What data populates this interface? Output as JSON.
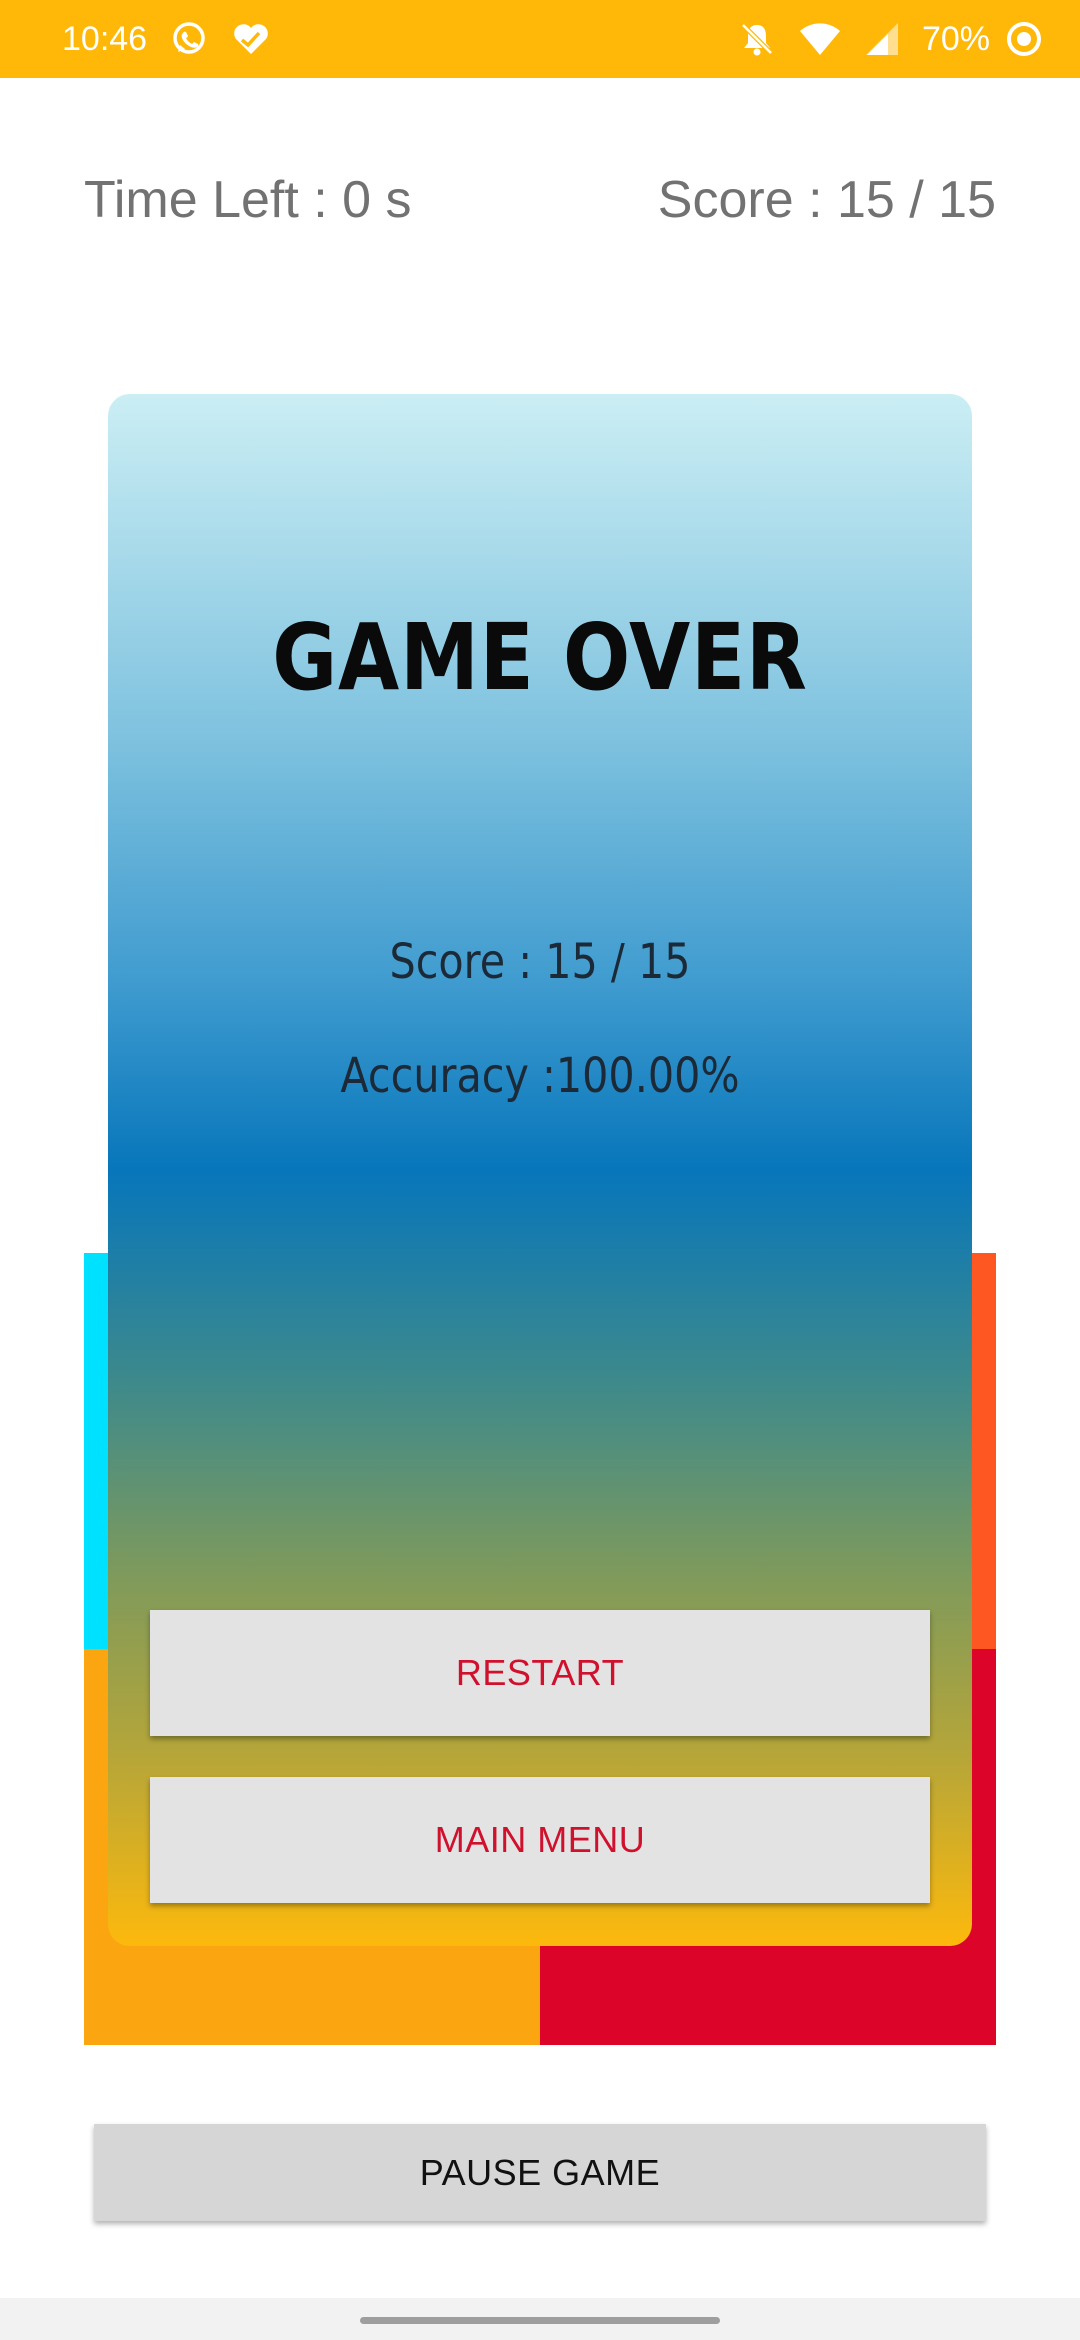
{
  "status_bar": {
    "time": "10:46",
    "battery_percent": "70%",
    "icons": [
      "whatsapp-icon",
      "health-heart-icon",
      "notifications-off-icon",
      "wifi-icon",
      "cell-signal-icon",
      "data-saver-icon"
    ],
    "background_color": "#FFB808"
  },
  "header": {
    "time_left": "Time Left : 0 s",
    "score": "Score : 15 / 15"
  },
  "board": {
    "tile_colors": [
      "#00E1FF",
      "#FF5722",
      "#FBA610",
      "#DC0428"
    ]
  },
  "game_over_dialog": {
    "title": "GAME OVER",
    "score": "Score : 15 / 15",
    "accuracy": "Accuracy :100.00%",
    "restart_label": "RESTART",
    "main_menu_label": "MAIN MENU",
    "button_text_color": "#D0112D"
  },
  "pause_button": {
    "label": "PAUSE GAME"
  }
}
